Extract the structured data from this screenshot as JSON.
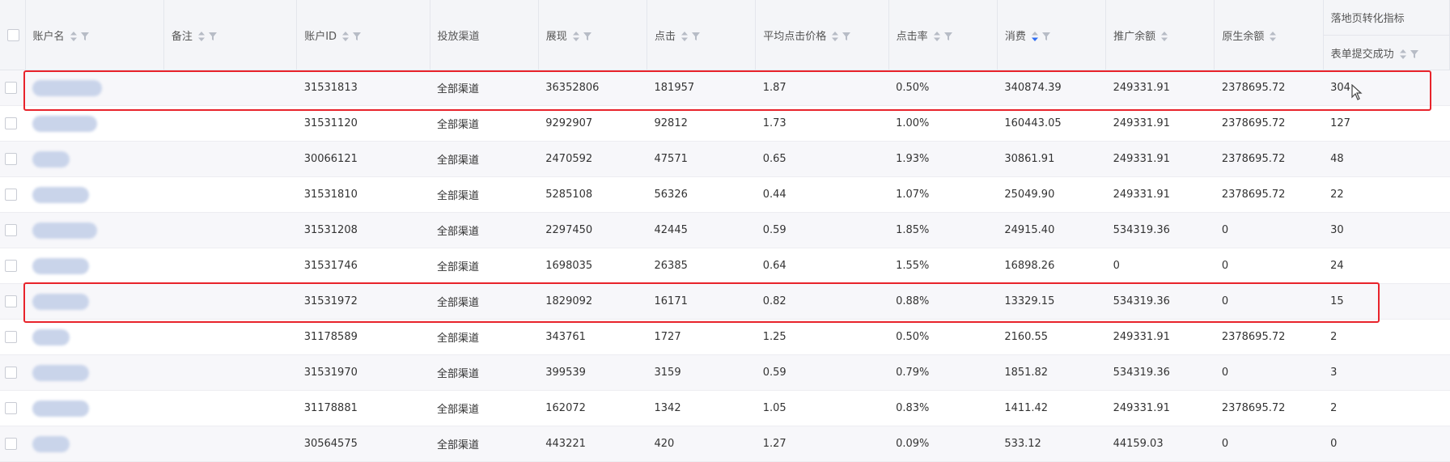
{
  "columns": {
    "account_name": "账户名",
    "remark": "备注",
    "account_id": "账户ID",
    "channel": "投放渠道",
    "impressions": "展现",
    "clicks": "点击",
    "avg_cpc": "平均点击价格",
    "ctr": "点击率",
    "cost": "消费",
    "promo_balance": "推广余额",
    "origin_balance": "原生余额",
    "landing_group": "落地页转化指标",
    "form_submit": "表单提交成功"
  },
  "rows": [
    {
      "account_id": "31531813",
      "channel": "全部渠道",
      "impressions": "36352806",
      "clicks": "181957",
      "avg_cpc": "1.87",
      "ctr": "0.50%",
      "cost": "340874.39",
      "promo_balance": "249331.91",
      "origin_balance": "2378695.72",
      "form_submit": "304"
    },
    {
      "account_id": "31531120",
      "channel": "全部渠道",
      "impressions": "9292907",
      "clicks": "92812",
      "avg_cpc": "1.73",
      "ctr": "1.00%",
      "cost": "160443.05",
      "promo_balance": "249331.91",
      "origin_balance": "2378695.72",
      "form_submit": "127"
    },
    {
      "account_id": "30066121",
      "channel": "全部渠道",
      "impressions": "2470592",
      "clicks": "47571",
      "avg_cpc": "0.65",
      "ctr": "1.93%",
      "cost": "30861.91",
      "promo_balance": "249331.91",
      "origin_balance": "2378695.72",
      "form_submit": "48"
    },
    {
      "account_id": "31531810",
      "channel": "全部渠道",
      "impressions": "5285108",
      "clicks": "56326",
      "avg_cpc": "0.44",
      "ctr": "1.07%",
      "cost": "25049.90",
      "promo_balance": "249331.91",
      "origin_balance": "2378695.72",
      "form_submit": "22"
    },
    {
      "account_id": "31531208",
      "channel": "全部渠道",
      "impressions": "2297450",
      "clicks": "42445",
      "avg_cpc": "0.59",
      "ctr": "1.85%",
      "cost": "24915.40",
      "promo_balance": "534319.36",
      "origin_balance": "0",
      "form_submit": "30"
    },
    {
      "account_id": "31531746",
      "channel": "全部渠道",
      "impressions": "1698035",
      "clicks": "26385",
      "avg_cpc": "0.64",
      "ctr": "1.55%",
      "cost": "16898.26",
      "promo_balance": "0",
      "origin_balance": "0",
      "form_submit": "24"
    },
    {
      "account_id": "31531972",
      "channel": "全部渠道",
      "impressions": "1829092",
      "clicks": "16171",
      "avg_cpc": "0.82",
      "ctr": "0.88%",
      "cost": "13329.15",
      "promo_balance": "534319.36",
      "origin_balance": "0",
      "form_submit": "15"
    },
    {
      "account_id": "31178589",
      "channel": "全部渠道",
      "impressions": "343761",
      "clicks": "1727",
      "avg_cpc": "1.25",
      "ctr": "0.50%",
      "cost": "2160.55",
      "promo_balance": "249331.91",
      "origin_balance": "2378695.72",
      "form_submit": "2"
    },
    {
      "account_id": "31531970",
      "channel": "全部渠道",
      "impressions": "399539",
      "clicks": "3159",
      "avg_cpc": "0.59",
      "ctr": "0.79%",
      "cost": "1851.82",
      "promo_balance": "534319.36",
      "origin_balance": "0",
      "form_submit": "3"
    },
    {
      "account_id": "31178881",
      "channel": "全部渠道",
      "impressions": "162072",
      "clicks": "1342",
      "avg_cpc": "1.05",
      "ctr": "0.83%",
      "cost": "1411.42",
      "promo_balance": "249331.91",
      "origin_balance": "2378695.72",
      "form_submit": "2"
    },
    {
      "account_id": "30564575",
      "channel": "全部渠道",
      "impressions": "443221",
      "clicks": "420",
      "avg_cpc": "1.27",
      "ctr": "0.09%",
      "cost": "533.12",
      "promo_balance": "44159.03",
      "origin_balance": "0",
      "form_submit": "0"
    }
  ],
  "sort": {
    "active_column": "cost",
    "direction": "desc"
  },
  "colors": {
    "highlight": "#e8232b",
    "active_sort": "#2f6df2",
    "header_bg": "#f4f5f8"
  }
}
